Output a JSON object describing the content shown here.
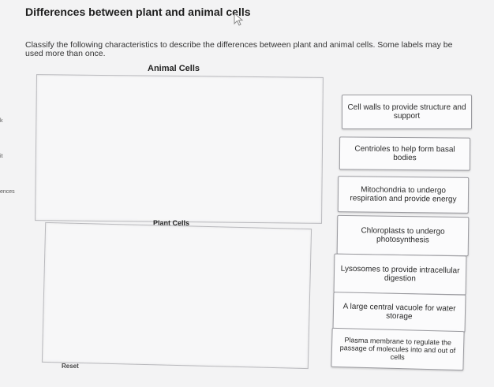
{
  "header": {
    "title": "Differences between plant and animal cells"
  },
  "instructions": "Classify the following characteristics to describe the differences between plant and animal cells. Some labels may be used more than once.",
  "buckets": {
    "animal_label": "Animal Cells",
    "plant_label": "Plant Cells"
  },
  "left_edge": {
    "fragments": [
      "k",
      "it",
      "ences"
    ]
  },
  "labels": [
    "Cell walls to provide structure and support",
    "Centrioles to help form basal bodies",
    "Mitochondria to undergo respiration and provide energy",
    "Chloroplasts to undergo photosynthesis",
    "Lysosomes to provide intracellular digestion",
    "A large central vacuole for water storage",
    "Plasma membrane to regulate the passage of molecules into and out of cells"
  ],
  "controls": {
    "reset_label": "Reset"
  },
  "colors": {
    "background": "#f3f3f4",
    "card_border": "#9b9ba0",
    "zone_border": "#b8b8bc",
    "cursor_outline": "#8a8a8a"
  },
  "icons": {
    "cursor": "mouse-pointer-icon"
  }
}
